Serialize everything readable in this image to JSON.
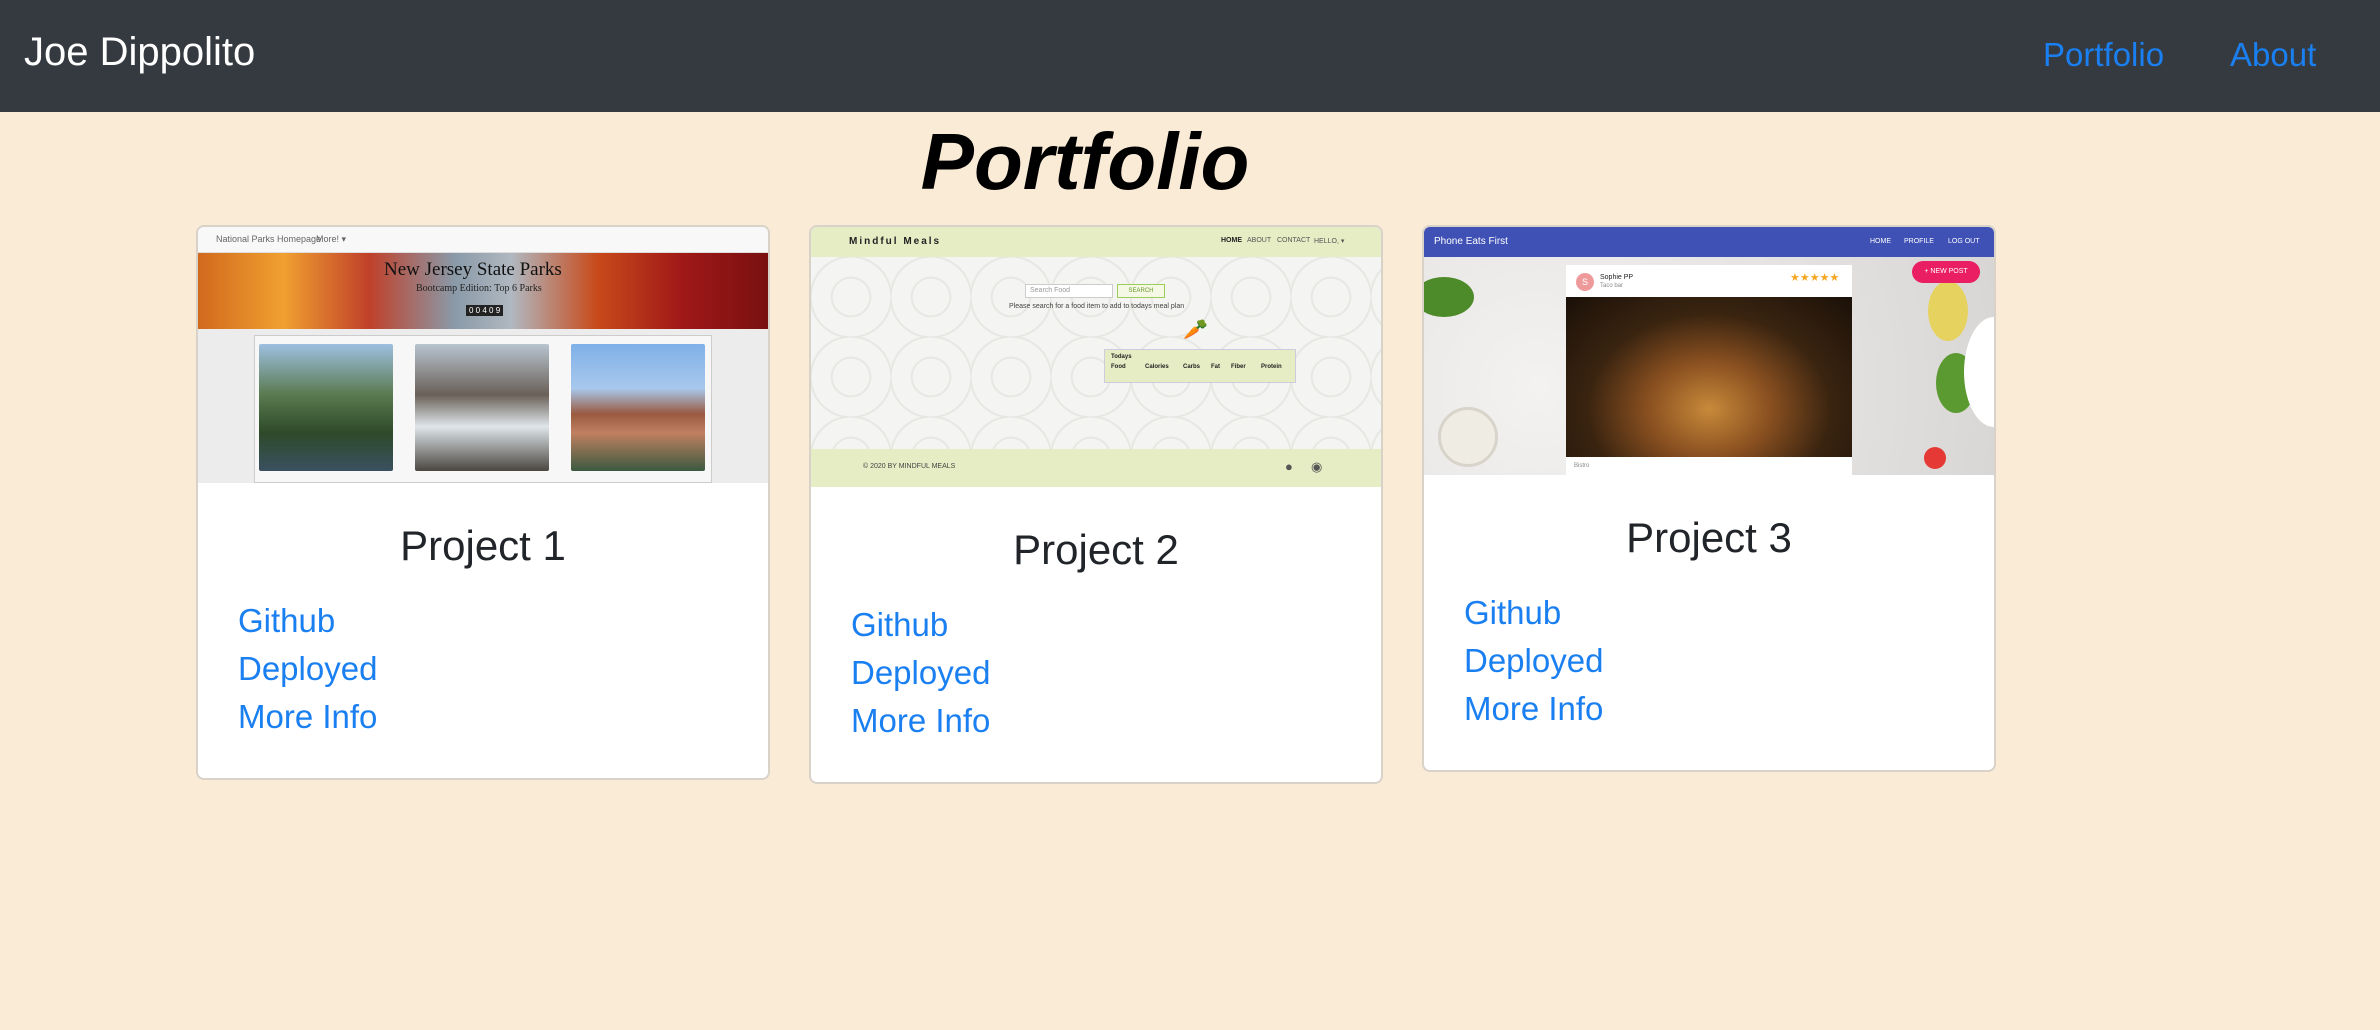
{
  "navbar": {
    "brand": "Joe Dippolito",
    "links": [
      "Portfolio",
      "About"
    ]
  },
  "page": {
    "title": "Portfolio"
  },
  "projects": [
    {
      "title": "Project 1",
      "links": [
        "Github",
        "Deployed",
        "More Info"
      ],
      "preview": {
        "nav_items": [
          "National Parks Homepage",
          "More! ▾"
        ],
        "heading": "New Jersey State Parks",
        "subheading": "Bootcamp Edition: Top 6 Parks",
        "counter": "0 0 4 0 9"
      }
    },
    {
      "title": "Project 2",
      "links": [
        "Github",
        "Deployed",
        "More Info"
      ],
      "preview": {
        "brand": "Mindful Meals",
        "nav_items": [
          "HOME",
          "ABOUT",
          "CONTACT",
          "HELLO, ▾"
        ],
        "search_placeholder": "Search Food",
        "search_button": "SEARCH",
        "hint": "Please search for a food item to add to todays meal plan",
        "table_title": "Todays",
        "table_headers": [
          "Food",
          "Calories",
          "Carbs",
          "Fat",
          "Fiber",
          "Protein"
        ],
        "footer": "© 2020 BY MINDFUL MEALS"
      }
    },
    {
      "title": "Project 3",
      "links": [
        "Github",
        "Deployed",
        "More Info"
      ],
      "preview": {
        "brand": "Phone Eats First",
        "nav_items": [
          "HOME",
          "PROFILE",
          "LOG OUT"
        ],
        "new_post": "+ NEW POST",
        "user_name": "Sophie PP",
        "user_sub": "Taco bar",
        "avatar_letter": "S",
        "stars": "★★★★★",
        "caption": "Bistro"
      }
    }
  ],
  "colors": {
    "navbar_bg": "#343a40",
    "page_bg": "#faebd7",
    "link": "#1a7ff0",
    "p3_header": "#3f51b5",
    "p3_accent": "#e91e63",
    "p2_green": "#e6ecc4"
  }
}
